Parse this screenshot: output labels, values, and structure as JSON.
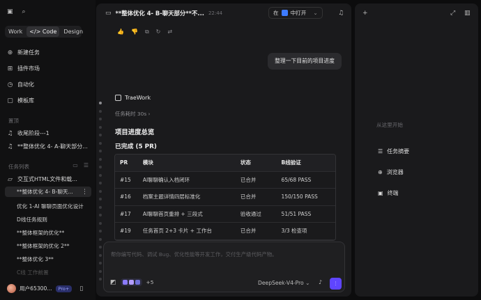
{
  "sidebar": {
    "tabs": [
      "Work",
      "Code",
      "Design"
    ],
    "active_tab": "Code",
    "nav": [
      {
        "label": "新建任务",
        "icon": "plus-circle-icon"
      },
      {
        "label": "插件市场",
        "icon": "plugin-icon"
      },
      {
        "label": "自动化",
        "icon": "clock-icon"
      },
      {
        "label": "模板库",
        "icon": "template-icon"
      }
    ],
    "pinned_title": "置顶",
    "pinned": [
      "收尾阶段---1",
      "**整体优化 4- A-聊天部分..."
    ],
    "tasks_title": "任务列表",
    "project": "交互式HTML文件和载...",
    "tasks": [
      "**整体优化 4- B-聊天...",
      "优化 1-AI 聊聊页面优化设计",
      "D线任务规则",
      "**整体框架的优化**",
      "**整体框架的优化 2**",
      "**整体优化 3**",
      "C线 工作前置"
    ],
    "user": "用户65300...",
    "plan": "Pro+"
  },
  "main": {
    "title": "**整体优化 4- B-聊天部分**不...",
    "time": "22:44",
    "open_in_prefix": "在",
    "open_in": "中打开",
    "user_message": "整理一下目前的项目进度",
    "brand": "TraeWork",
    "task_time": "任务耗时 30s",
    "heading": "项目进度总览",
    "subheading": "已完成 (5 PR)",
    "table": {
      "headers": [
        "PR",
        "模块",
        "状态",
        "B线验证"
      ],
      "rows": [
        [
          "#15",
          "AI聊聊确认入档闭环",
          "已合并",
          "65/68 PASS"
        ],
        [
          "#16",
          "档案主题详情四层标准化",
          "已合并",
          "150/150 PASS"
        ],
        [
          "#17",
          "AI聊聊首页重排 + 三段式",
          "验收通过",
          "51/51 PASS"
        ],
        [
          "#19",
          "任务首页 2+3 卡片 + 工作台",
          "已合并",
          "3/3 检查项"
        ]
      ]
    },
    "composer": {
      "placeholder": "帮你编写代码、调试 Bug、优化性能等开发工作，交付生产级代码产物。",
      "extra_count": "+5",
      "model": "DeepSeek-V4-Pro"
    }
  },
  "right": {
    "hint": "从这里开始",
    "items": [
      {
        "label": "任务摘要",
        "icon": "list-icon"
      },
      {
        "label": "浏览器",
        "icon": "globe-icon"
      },
      {
        "label": "终端",
        "icon": "terminal-icon"
      }
    ]
  },
  "colors": {
    "accent": "#5f45ff",
    "background": "#0c0c0d",
    "panel": "#1a1a1c"
  }
}
